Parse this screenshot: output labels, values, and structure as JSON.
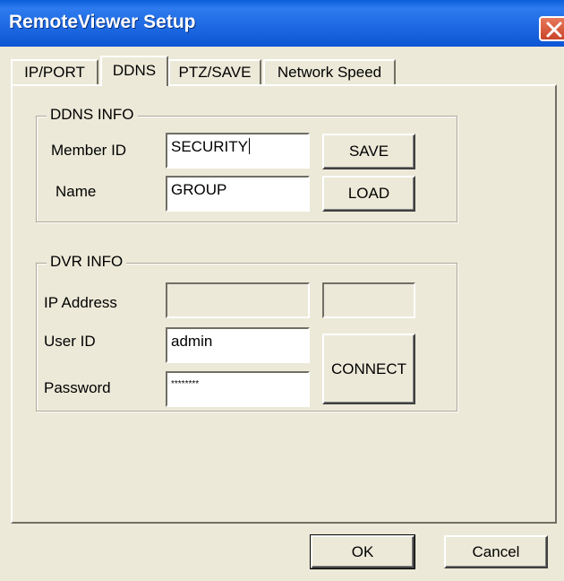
{
  "window": {
    "title": "RemoteViewer Setup"
  },
  "tabs": [
    {
      "label": "IP/PORT",
      "active": false
    },
    {
      "label": "DDNS",
      "active": true
    },
    {
      "label": "PTZ/SAVE",
      "active": false
    },
    {
      "label": "Network Speed",
      "active": false
    }
  ],
  "ddns": {
    "group_title": "DDNS INFO",
    "member_id_label": "Member ID",
    "member_id_value": "SECURITY",
    "name_label": "Name",
    "name_value": "GROUP",
    "save_label": "SAVE",
    "load_label": "LOAD"
  },
  "dvr": {
    "group_title": "DVR INFO",
    "ip_label": "IP Address",
    "ip_value": "",
    "port_value": "",
    "user_label": "User ID",
    "user_value": "admin",
    "password_label": "Password",
    "password_value": "********",
    "connect_label": "CONNECT"
  },
  "footer": {
    "ok_label": "OK",
    "cancel_label": "Cancel"
  },
  "colors": {
    "titlebar": "#0a5fd8",
    "window_bg": "#ece9d8",
    "close_button": "#c9442a"
  },
  "icons": {
    "close": "close-icon"
  }
}
